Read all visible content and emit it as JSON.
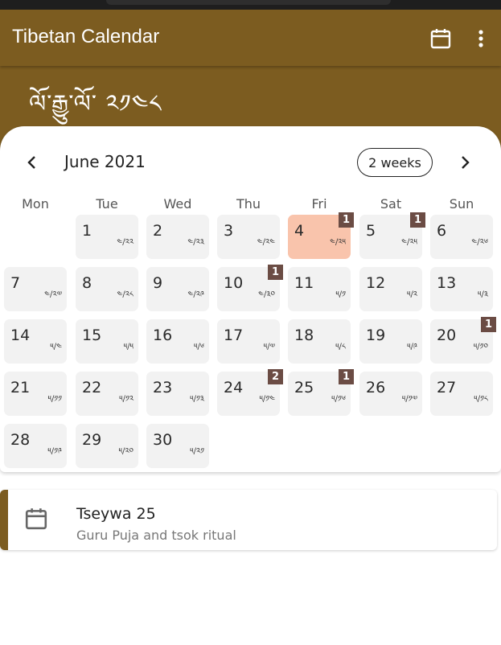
{
  "app": {
    "title": "Tibetan Calendar"
  },
  "year_banner": "ལོ་རྒྱུ་ལོ་ ༢༡༤༨",
  "calendar": {
    "month_label": "June 2021",
    "format_label": "2 weeks",
    "weekdays": [
      "Mon",
      "Tue",
      "Wed",
      "Thu",
      "Fri",
      "Sat",
      "Sun"
    ],
    "days": [
      {
        "day": "1",
        "tib": "༤/༢༢",
        "badge": ""
      },
      {
        "day": "2",
        "tib": "༤/༢༣",
        "badge": ""
      },
      {
        "day": "3",
        "tib": "༤/༢༤",
        "badge": ""
      },
      {
        "day": "4",
        "tib": "༤/༢༥",
        "badge": "1",
        "today": true
      },
      {
        "day": "5",
        "tib": "༤/༢༥",
        "badge": "1"
      },
      {
        "day": "6",
        "tib": "༤/༢༦",
        "badge": ""
      },
      {
        "day": "7",
        "tib": "༤/༢༧",
        "badge": ""
      },
      {
        "day": "8",
        "tib": "༤/༢༨",
        "badge": ""
      },
      {
        "day": "9",
        "tib": "༤/༢༩",
        "badge": ""
      },
      {
        "day": "10",
        "tib": "༤/༣༠",
        "badge": "1"
      },
      {
        "day": "11",
        "tib": "༥/༡",
        "badge": ""
      },
      {
        "day": "12",
        "tib": "༥/༢",
        "badge": ""
      },
      {
        "day": "13",
        "tib": "༥/༣",
        "badge": ""
      },
      {
        "day": "14",
        "tib": "༥/༤",
        "badge": ""
      },
      {
        "day": "15",
        "tib": "༥/༥",
        "badge": ""
      },
      {
        "day": "16",
        "tib": "༥/༦",
        "badge": ""
      },
      {
        "day": "17",
        "tib": "༥/༧",
        "badge": ""
      },
      {
        "day": "18",
        "tib": "༥/༨",
        "badge": ""
      },
      {
        "day": "19",
        "tib": "༥/༩",
        "badge": ""
      },
      {
        "day": "20",
        "tib": "༥/༡༠",
        "badge": "1"
      },
      {
        "day": "21",
        "tib": "༥/༡༡",
        "badge": ""
      },
      {
        "day": "22",
        "tib": "༥/༡༢",
        "badge": ""
      },
      {
        "day": "23",
        "tib": "༥/༡༣",
        "badge": ""
      },
      {
        "day": "24",
        "tib": "༥/༡༤",
        "badge": "2"
      },
      {
        "day": "25",
        "tib": "༥/༡༦",
        "badge": "1"
      },
      {
        "day": "26",
        "tib": "༥/༡༧",
        "badge": ""
      },
      {
        "day": "27",
        "tib": "༥/༡༨",
        "badge": ""
      },
      {
        "day": "28",
        "tib": "༥/༡༩",
        "badge": ""
      },
      {
        "day": "29",
        "tib": "༥/༢༠",
        "badge": ""
      },
      {
        "day": "30",
        "tib": "༥/༢༡",
        "badge": ""
      }
    ]
  },
  "event": {
    "title": "Tseywa 25",
    "subtitle": "Guru Puja and tsok ritual",
    "icon": "calendar-icon"
  },
  "colors": {
    "primary": "#7c5c20",
    "today": "#f9c4ac",
    "badge": "#6b4c44",
    "cell": "#f2f2f2"
  }
}
